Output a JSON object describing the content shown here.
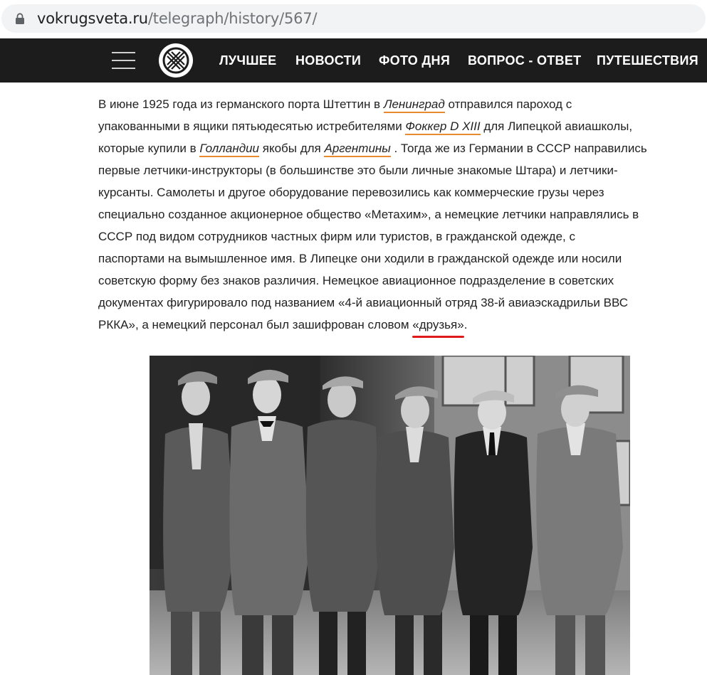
{
  "browser": {
    "url_host": "vokrugsveta.ru",
    "url_path": "/telegraph/history/567/"
  },
  "header": {
    "nav": [
      {
        "label": "ЛУЧШЕЕ"
      },
      {
        "label": "НОВОСТИ"
      },
      {
        "label": "ФОТО ДНЯ"
      },
      {
        "label": "ВОПРОС - ОТВЕТ"
      },
      {
        "label": "ПУТЕШЕСТВИЯ"
      }
    ]
  },
  "article": {
    "l1_a": "В июне 1925 года из германского порта Штеттин в ",
    "link_leningrad": "Ленинград",
    "l1_b": " отправился пароход с",
    "l2_a": "упакованными в ящики пятьюдесятью истребителями ",
    "link_fokker": "Фоккер D XIII",
    "l2_b": " для Липецкой авиашколы,",
    "l3_a": "которые купили в ",
    "link_holland": "Голландии",
    "l3_b": " якобы для ",
    "link_argentina": "Аргентины",
    "l3_c": " . Тогда же из Германии в СССР направились",
    "l4": "первые летчики-инструкторы (в большинстве это были личные знакомые Штара) и летчики-",
    "l5": "курсанты. Самолеты и другое оборудование перевозились как коммерческие грузы через",
    "l6": "специально созданное акционерное общество «Метахим», а немецкие летчики направлялись в",
    "l7": "СССР под видом сотрудников частных фирм или туристов, в гражданской одежде, с",
    "l8": "паспортами на вымышленное имя. В Липецке они ходили в гражданской одежде или носили",
    "l9": "советскую форму без знаков различия. Немецкое авиационное подразделение в советских",
    "l10": "документах фигурировало под названием «4-й авиационный отряд 38-й авиаэскадрильи ВВС",
    "l11_a": "РККА», а немецкий персонал был зашифрован словом ",
    "highlight_friends": "«друзья»",
    "l11_b": "."
  },
  "colors": {
    "header_bg": "#1c1c1c",
    "link_underline": "#ea8a2e",
    "highlight_underline": "#e01a1a"
  }
}
